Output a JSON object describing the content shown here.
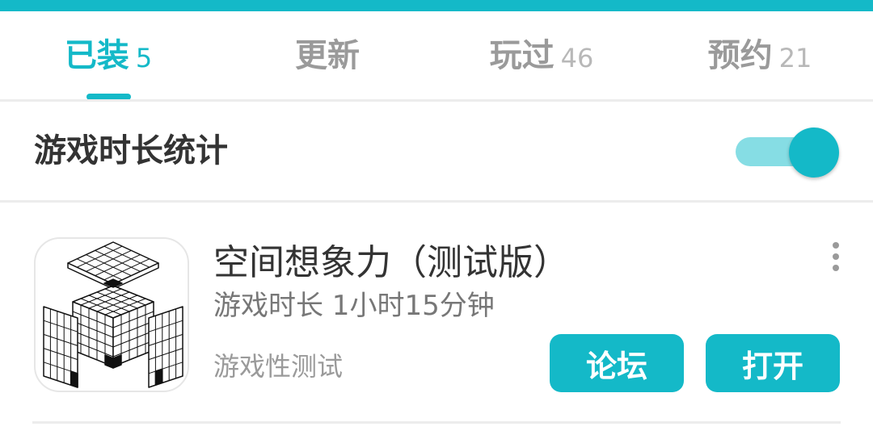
{
  "colors": {
    "accent": "#14b9c8",
    "accent_light": "#86dde4",
    "text_dark": "#333333",
    "text_muted": "#9a9a9a"
  },
  "tabs": [
    {
      "label": "已装",
      "count": "5",
      "active": true
    },
    {
      "label": "更新",
      "count": "",
      "active": false
    },
    {
      "label": "玩过",
      "count": "46",
      "active": false
    },
    {
      "label": "预约",
      "count": "21",
      "active": false
    }
  ],
  "settings": {
    "playtime_stats_label": "游戏时长统计",
    "playtime_stats_enabled": true
  },
  "game": {
    "title": "空间想象力（测试版）",
    "playtime": "游戏时长 1小时15分钟",
    "tag": "游戏性测试",
    "icon": "cube-grid-icon",
    "forum_label": "论坛",
    "open_label": "打开"
  }
}
